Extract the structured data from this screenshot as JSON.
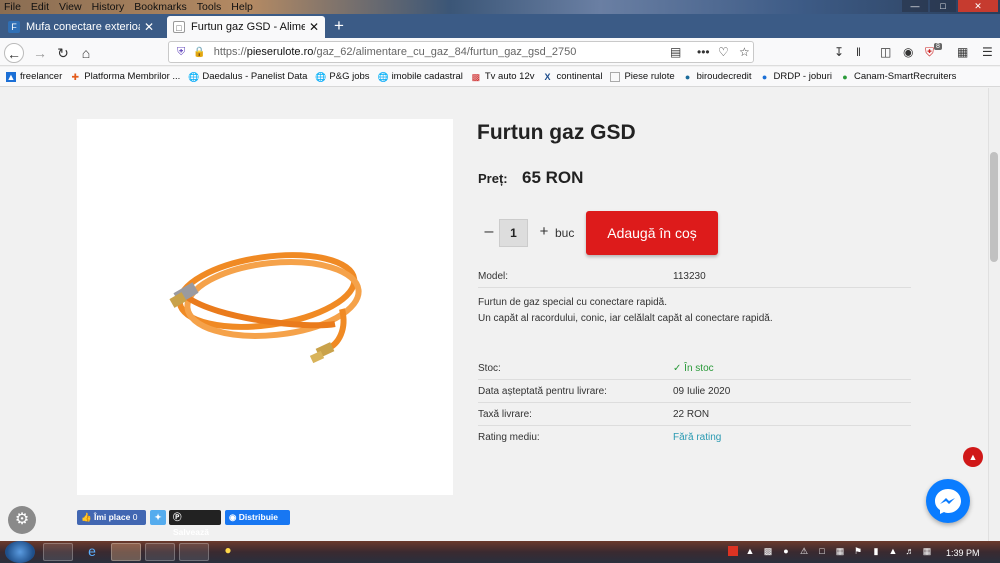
{
  "menu": [
    "File",
    "Edit",
    "View",
    "History",
    "Bookmarks",
    "Tools",
    "Help"
  ],
  "tabs": [
    {
      "label": "Mufa conectare exterioara pent"
    },
    {
      "label": "Furtun gaz GSD - Alimentare cu"
    }
  ],
  "url": {
    "prefix": "https://",
    "host": "pieserulote.ro",
    "path": "/gaz_62/alimentare_cu_gaz_84/furtun_gaz_gsd_2750"
  },
  "bookmarks": [
    "freelancer",
    "Platforma Membrilor ...",
    "Daedalus - Panelist Data",
    "P&G jobs",
    "imobile cadastral",
    "Tv auto 12v",
    "continental",
    "Piese rulote",
    "biroudecredit",
    "DRDP - joburi",
    "Canam-SmartRecruiters"
  ],
  "addon_badge": "8",
  "product": {
    "title": "Furtun gaz GSD",
    "price_label": "Preț:",
    "price": "65 RON",
    "qty": "1",
    "unit": "buc",
    "add_to_cart": "Adaugă în coș",
    "model_label": "Model:",
    "model": "113230",
    "desc1": "Furtun de gaz special cu conectare rapidă.",
    "desc2": "Un capăt al racordului, conic, iar celălalt capăt al conectare rapidă.",
    "stock_label": "Stoc:",
    "stock": "În stoc",
    "delivery_label": "Data așteptată pentru livrare:",
    "delivery": "09 Iulie 2020",
    "fee_label": "Taxă livrare:",
    "fee": "22 RON",
    "rating_label": "Rating mediu:",
    "rating": "Fără rating"
  },
  "social": {
    "like": "Îmi place",
    "like_count": "0",
    "save": "Salvează",
    "share": "Distribuie"
  },
  "clock": "1:39 PM",
  "colors": {
    "add_to_cart": "#dd1b1b",
    "in_stock": "#2a9a3a",
    "rating_link": "#2a9ab2",
    "messenger": "#0a7cff"
  }
}
